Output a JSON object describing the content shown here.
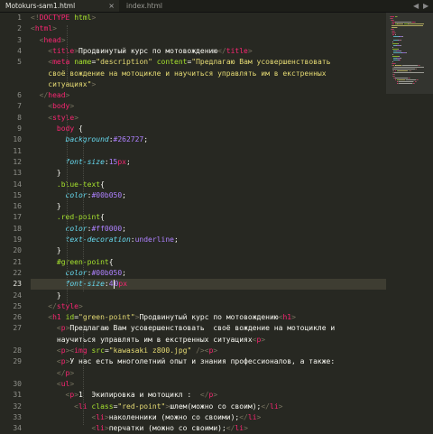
{
  "tabs": [
    {
      "label": "Motokurs-sam1.html",
      "active": true,
      "close": "×"
    },
    {
      "label": "index.html",
      "active": false
    }
  ],
  "tab_controls": {
    "left": "◀",
    "right": "▶"
  },
  "current_line": 23,
  "line_numbers": [
    "1",
    "2",
    "3",
    "4",
    "5",
    "",
    "",
    "6",
    "7",
    "8",
    "9",
    "10",
    "11",
    "12",
    "13",
    "14",
    "15",
    "16",
    "17",
    "18",
    "19",
    "20",
    "21",
    "22",
    "23",
    "24",
    "25",
    "26",
    "27",
    "",
    "28",
    "29",
    "",
    "30",
    "31",
    "32",
    "33",
    "34"
  ],
  "code": [
    [
      [
        "c",
        "<!"
      ],
      [
        "t",
        "DOCTYPE"
      ],
      [
        "p",
        " "
      ],
      [
        "a",
        "html"
      ],
      [
        "c",
        ">"
      ]
    ],
    [
      [
        "c",
        "<"
      ],
      [
        "t",
        "html"
      ],
      [
        "c",
        ">"
      ]
    ],
    [
      [
        "p",
        "  "
      ],
      [
        "c",
        "<"
      ],
      [
        "t",
        "head"
      ],
      [
        "c",
        ">"
      ]
    ],
    [
      [
        "p",
        "    "
      ],
      [
        "c",
        "<"
      ],
      [
        "t",
        "title"
      ],
      [
        "c",
        ">"
      ],
      [
        "p",
        "Продвинутый курс по мотовождению"
      ],
      [
        "c",
        "</"
      ],
      [
        "t",
        "title"
      ],
      [
        "c",
        ">"
      ]
    ],
    [
      [
        "p",
        "    "
      ],
      [
        "c",
        "<"
      ],
      [
        "t",
        "meta"
      ],
      [
        "p",
        " "
      ],
      [
        "a",
        "name"
      ],
      [
        "p",
        "="
      ],
      [
        "s",
        "\"description\""
      ],
      [
        "p",
        " "
      ],
      [
        "a",
        "content"
      ],
      [
        "p",
        "="
      ],
      [
        "s",
        "\"Предлагаю Вам усовершенствовать"
      ]
    ],
    [
      [
        "s",
        "    своё вождение на мотоцикле и научиться управлять им в екстренных"
      ]
    ],
    [
      [
        "s",
        "    ситуациях\""
      ],
      [
        "c",
        ">"
      ]
    ],
    [
      [
        "p",
        "  "
      ],
      [
        "c",
        "</"
      ],
      [
        "t",
        "head"
      ],
      [
        "c",
        ">"
      ]
    ],
    [
      [
        "p",
        "    "
      ],
      [
        "c",
        "<"
      ],
      [
        "t",
        "body"
      ],
      [
        "c",
        ">"
      ]
    ],
    [
      [
        "p",
        "    "
      ],
      [
        "c",
        "<"
      ],
      [
        "t",
        "style"
      ],
      [
        "c",
        ">"
      ]
    ],
    [
      [
        "p",
        "      "
      ],
      [
        "t",
        "body"
      ],
      [
        "p",
        " {"
      ]
    ],
    [
      [
        "p",
        "        "
      ],
      [
        "k",
        "background"
      ],
      [
        "p",
        ":"
      ],
      [
        "v",
        "#262727"
      ],
      [
        "p",
        ";"
      ]
    ],
    [
      [
        "p",
        " "
      ]
    ],
    [
      [
        "p",
        "        "
      ],
      [
        "k",
        "font-size"
      ],
      [
        "p",
        ":"
      ],
      [
        "v",
        "15"
      ],
      [
        "t",
        "px"
      ],
      [
        "p",
        ";"
      ]
    ],
    [
      [
        "p",
        "      }"
      ]
    ],
    [
      [
        "p",
        "      "
      ],
      [
        "cls",
        ".blue-text"
      ],
      [
        "p",
        "{"
      ]
    ],
    [
      [
        "p",
        "        "
      ],
      [
        "k",
        "color"
      ],
      [
        "p",
        ":"
      ],
      [
        "v",
        "#00b050"
      ],
      [
        "p",
        ";"
      ]
    ],
    [
      [
        "p",
        "      }"
      ]
    ],
    [
      [
        "p",
        "      "
      ],
      [
        "cls",
        ".red-point"
      ],
      [
        "p",
        "{"
      ]
    ],
    [
      [
        "p",
        "        "
      ],
      [
        "k",
        "color"
      ],
      [
        "p",
        ":"
      ],
      [
        "v",
        "#ff0000"
      ],
      [
        "p",
        ";"
      ]
    ],
    [
      [
        "p",
        "        "
      ],
      [
        "k",
        "text-decoration"
      ],
      [
        "p",
        ":"
      ],
      [
        "v",
        "underline"
      ],
      [
        "p",
        ";"
      ]
    ],
    [
      [
        "p",
        "      }"
      ]
    ],
    [
      [
        "p",
        "      "
      ],
      [
        "cls",
        "#green-point"
      ],
      [
        "p",
        "{"
      ]
    ],
    [
      [
        "p",
        "        "
      ],
      [
        "k",
        "color"
      ],
      [
        "p",
        ":"
      ],
      [
        "v",
        "#00b050"
      ],
      [
        "p",
        ";"
      ]
    ],
    [
      [
        "p",
        "        "
      ],
      [
        "k",
        "font-size"
      ],
      [
        "p",
        ":"
      ],
      [
        "v",
        "4"
      ],
      [
        "caret",
        ""
      ],
      [
        "v",
        "0"
      ],
      [
        "t",
        "px"
      ]
    ],
    [
      [
        "p",
        "      }"
      ]
    ],
    [
      [
        "p",
        "    "
      ],
      [
        "c",
        "</"
      ],
      [
        "t",
        "style"
      ],
      [
        "c",
        ">"
      ]
    ],
    [
      [
        "p",
        "    "
      ],
      [
        "c",
        "<"
      ],
      [
        "t",
        "h1"
      ],
      [
        "p",
        " "
      ],
      [
        "a",
        "id"
      ],
      [
        "p",
        "="
      ],
      [
        "s",
        "\"green-point\""
      ],
      [
        "c",
        ">"
      ],
      [
        "p",
        "Продвинутый курс по мотовождению"
      ],
      [
        "c",
        "<"
      ],
      [
        "t",
        "h1"
      ],
      [
        "c",
        ">"
      ]
    ],
    [
      [
        "p",
        "      "
      ],
      [
        "c",
        "<"
      ],
      [
        "t",
        "p"
      ],
      [
        "c",
        ">"
      ],
      [
        "p",
        "Предлагаю Вам усовершенствовать  своё вождение на мотоцикле и"
      ]
    ],
    [
      [
        "p",
        "      научиться управлять им в екстренных ситуациях"
      ],
      [
        "c",
        "<"
      ],
      [
        "t",
        "p"
      ],
      [
        "c",
        ">"
      ]
    ],
    [
      [
        "p",
        "      "
      ],
      [
        "c",
        "<"
      ],
      [
        "t",
        "p"
      ],
      [
        "c",
        "><"
      ],
      [
        "t",
        "img"
      ],
      [
        "p",
        " "
      ],
      [
        "a",
        "src"
      ],
      [
        "p",
        "="
      ],
      [
        "s",
        "\"kawasaki z800.jpg\""
      ],
      [
        "p",
        " "
      ],
      [
        "c",
        "/><"
      ],
      [
        "t",
        "p"
      ],
      [
        "c",
        ">"
      ]
    ],
    [
      [
        "p",
        "      "
      ],
      [
        "c",
        "<"
      ],
      [
        "t",
        "p"
      ],
      [
        "c",
        ">"
      ],
      [
        "p",
        "У нас есть многолетний опыт и знания профессионалов, а также:"
      ]
    ],
    [
      [
        "p",
        "      "
      ],
      [
        "c",
        "</"
      ],
      [
        "t",
        "p"
      ],
      [
        "c",
        ">"
      ]
    ],
    [
      [
        "p",
        "      "
      ],
      [
        "c",
        "<"
      ],
      [
        "t",
        "ul"
      ],
      [
        "c",
        ">"
      ]
    ],
    [
      [
        "p",
        "        "
      ],
      [
        "c",
        "<"
      ],
      [
        "t",
        "p"
      ],
      [
        "c",
        ">"
      ],
      [
        "p",
        "1  Экипировка и мотоцикл :  "
      ],
      [
        "c",
        "</"
      ],
      [
        "t",
        "p"
      ],
      [
        "c",
        ">"
      ]
    ],
    [
      [
        "p",
        "          "
      ],
      [
        "c",
        "<"
      ],
      [
        "t",
        "li"
      ],
      [
        "p",
        " "
      ],
      [
        "a",
        "class"
      ],
      [
        "p",
        "="
      ],
      [
        "s",
        "\"red-point\""
      ],
      [
        "c",
        ">"
      ],
      [
        "p",
        "шлем(можно со своим);"
      ],
      [
        "c",
        "</"
      ],
      [
        "t",
        "li"
      ],
      [
        "c",
        ">"
      ]
    ],
    [
      [
        "p",
        "              "
      ],
      [
        "c",
        "<"
      ],
      [
        "t",
        "li"
      ],
      [
        "c",
        ">"
      ],
      [
        "p",
        "наколенники (можно со своими);"
      ],
      [
        "c",
        "</"
      ],
      [
        "t",
        "li"
      ],
      [
        "c",
        ">"
      ]
    ],
    [
      [
        "p",
        "              "
      ],
      [
        "c",
        "<"
      ],
      [
        "t",
        "li"
      ],
      [
        "c",
        ">"
      ],
      [
        "p",
        "перчатки (можно со своими);"
      ],
      [
        "c",
        "</"
      ],
      [
        "t",
        "li"
      ],
      [
        "c",
        ">"
      ]
    ]
  ],
  "minimap_colors": [
    "#75715e",
    "#f92672",
    "#f92672",
    "#e6db74",
    "#e6db74",
    "#e6db74",
    "#a6e22e",
    "#66d9ef",
    "#ae81ff"
  ]
}
